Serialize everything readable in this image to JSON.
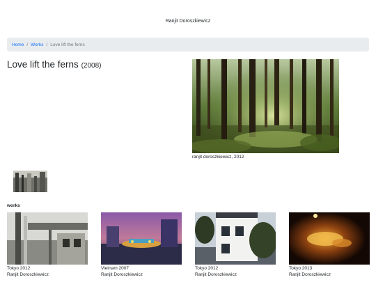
{
  "site": {
    "title": "Ranjit Doroszkiewicz"
  },
  "breadcrumb": {
    "home": "Home",
    "works": "Works",
    "current": "Love lift the ferns"
  },
  "work": {
    "title": "Love lift the ferns",
    "year": "(2008)",
    "caption": "ranjit doroszkiewicz, 2012"
  },
  "works_section": {
    "heading": "works",
    "items": [
      {
        "place_year": "Tokyo 2012",
        "artist": "Ranjit Doroszkiewicz"
      },
      {
        "place_year": "Vietnam 2007",
        "artist": "Ranjit Doroszkiewicz"
      },
      {
        "place_year": "Tokyo 2012",
        "artist": "Ranjit Doroszkiewicz"
      },
      {
        "place_year": "Tokyo 2013",
        "artist": "Ranjit Doroszkiewicz"
      }
    ]
  }
}
